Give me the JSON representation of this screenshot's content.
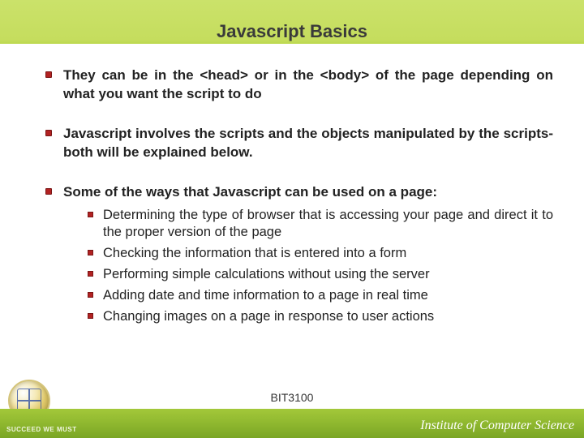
{
  "title": "Javascript Basics",
  "bullets": [
    {
      "text": "They can be in the <head> or in the <body> of the page depending on what you want the script to do"
    },
    {
      "text": "Javascript involves the scripts and the objects manipulated by the scripts- both will be explained below."
    },
    {
      "text": "Some of the ways that Javascript can be used on a page:",
      "subs": [
        "Determining the type of browser that is accessing your page and direct it to the proper version of the page",
        "Checking the information that is entered into a form",
        "Performing simple calculations without using the server",
        "Adding date and time information to a page in real time",
        "Changing images on a page in response to user actions"
      ]
    }
  ],
  "course_code": "BIT3100",
  "footer": {
    "motto": "SUCCEED WE MUST",
    "department": "Institute of Computer Science"
  }
}
